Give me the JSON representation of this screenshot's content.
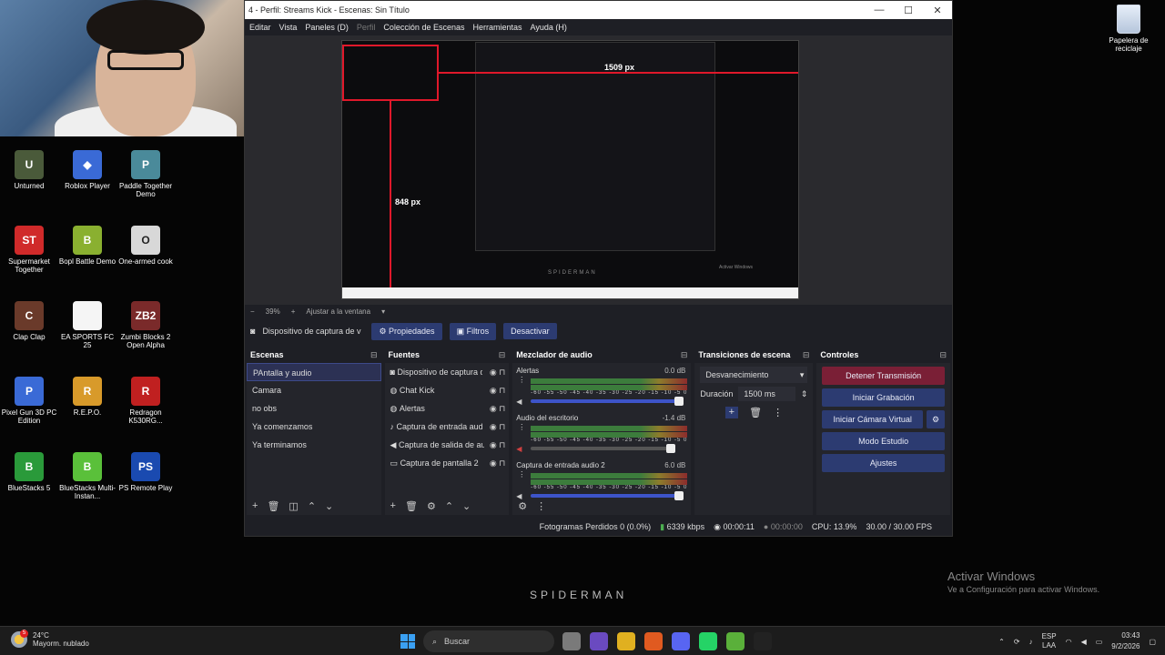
{
  "desktop_icons": [
    {
      "label": "Unturned",
      "color": "#4a5a3a",
      "glyph": "U"
    },
    {
      "label": "Roblox Player",
      "color": "#3a6ad6",
      "glyph": "◆"
    },
    {
      "label": "Paddle Together Demo",
      "color": "#4a8a9a",
      "glyph": "P"
    },
    {
      "label": "Supermarket Together",
      "color": "#d02a2a",
      "glyph": "ST"
    },
    {
      "label": "Bopl Battle Demo",
      "color": "#8ab030",
      "glyph": "B"
    },
    {
      "label": "One-armed cook",
      "color": "#d8d8d8",
      "glyph": "O"
    },
    {
      "label": "Clap Clap",
      "color": "#6a3a2a",
      "glyph": "C"
    },
    {
      "label": "EA SPORTS FC 25",
      "color": "#f5f5f5",
      "glyph": ""
    },
    {
      "label": "Zumbi Blocks 2 Open Alpha",
      "color": "#7a2a2a",
      "glyph": "ZB2"
    },
    {
      "label": "Pixel Gun 3D PC Edition",
      "color": "#3a6ad6",
      "glyph": "P"
    },
    {
      "label": "R.E.P.O.",
      "color": "#d89a2a",
      "glyph": "R"
    },
    {
      "label": "Redragon K530RG...",
      "color": "#c02020",
      "glyph": "R"
    },
    {
      "label": "BlueStacks 5",
      "color": "#2a9a3a",
      "glyph": "B"
    },
    {
      "label": "BlueStacks Multi-Instan...",
      "color": "#5ac03a",
      "glyph": "B"
    },
    {
      "label": "PS Remote Play",
      "color": "#1a4ab0",
      "glyph": "PS"
    }
  ],
  "recycle_bin": {
    "label": "Papelera de reciclaje"
  },
  "obs": {
    "title": "4 - Perfil: Streams Kick - Escenas: Sin Título",
    "menu": [
      "Editar",
      "Vista",
      "Paneles (D)",
      "Perfil",
      "Colección de Escenas",
      "Herramientas",
      "Ayuda (H)"
    ],
    "preview": {
      "width_label": "1509 px",
      "height_label": "848 px",
      "zoom": "39%",
      "fit_label": "Ajustar a la ventana",
      "inner_spider": "SPIDERMAN",
      "inner_activate": "Activar Windows"
    },
    "source_bar": {
      "source_name": "Dispositivo de captura de v",
      "properties": "Propiedades",
      "filters": "Filtros",
      "deactivate": "Desactivar"
    },
    "scenes": {
      "title": "Escenas",
      "items": [
        "PAntalla y audio",
        "Camara",
        "no obs",
        "Ya comenzamos",
        "Ya terminamos"
      ]
    },
    "sources": {
      "title": "Fuentes",
      "items": [
        {
          "label": "Dispositivo de captura d",
          "icon": "camera-icon",
          "glyph": "◙"
        },
        {
          "label": "Chat Kick",
          "icon": "globe-icon",
          "glyph": "◍"
        },
        {
          "label": "Alertas",
          "icon": "globe-icon",
          "glyph": "◍"
        },
        {
          "label": "Captura de entrada aud",
          "icon": "microphone-icon",
          "glyph": "♪"
        },
        {
          "label": "Captura de salida de au",
          "icon": "speaker-icon",
          "glyph": "◀"
        },
        {
          "label": "Captura de pantalla 2",
          "icon": "monitor-icon",
          "glyph": "▭"
        }
      ]
    },
    "mixer": {
      "title": "Mezclador de audio",
      "scale": "-60 -55 -50 -45 -40 -35 -30 -25 -20 -15 -10 -5 0",
      "tracks": [
        {
          "name": "Alertas",
          "db": "0.0 dB",
          "level": 1.0,
          "muted": false
        },
        {
          "name": "Audio del escritorio",
          "db": "-1.4 dB",
          "level": 0.95,
          "muted": true
        },
        {
          "name": "Captura de entrada audio 2",
          "db": "6.0 dB",
          "level": 1.0,
          "muted": false
        }
      ]
    },
    "transitions": {
      "title": "Transiciones de escena",
      "selected": "Desvanecimiento",
      "duration_label": "Duración",
      "duration_value": "1500 ms"
    },
    "controls": {
      "title": "Controles",
      "stop_stream": "Detener Transmisión",
      "start_recording": "Iniciar Grabación",
      "start_virtual_cam": "Iniciar Cámara Virtual",
      "studio_mode": "Modo Estudio",
      "settings": "Ajustes"
    },
    "status": {
      "dropped": "Fotogramas Perdidos 0 (0.0%)",
      "kbps": "6339 kbps",
      "stream_time": "00:00:11",
      "rec_time": "00:00:00",
      "cpu": "CPU: 13.9%",
      "fps": "30.00 / 30.00 FPS"
    }
  },
  "overlay": {
    "spiderman": "SPIDERMAN",
    "activate_title": "Activar Windows",
    "activate_sub": "Ve a Configuración para activar Windows."
  },
  "taskbar": {
    "weather_temp": "24°C",
    "weather_desc": "Mayorm. nublado",
    "weather_badge": "5",
    "search_placeholder": "Buscar",
    "apps": [
      "#7a7a7a",
      "#6a4ac0",
      "#e0b020",
      "#e05a20",
      "#5865f2",
      "#25d366",
      "#5ab03a",
      "#222222"
    ],
    "lang": "ESP",
    "lang2": "LAA",
    "time": "03:43",
    "date": "9/2/2026"
  }
}
